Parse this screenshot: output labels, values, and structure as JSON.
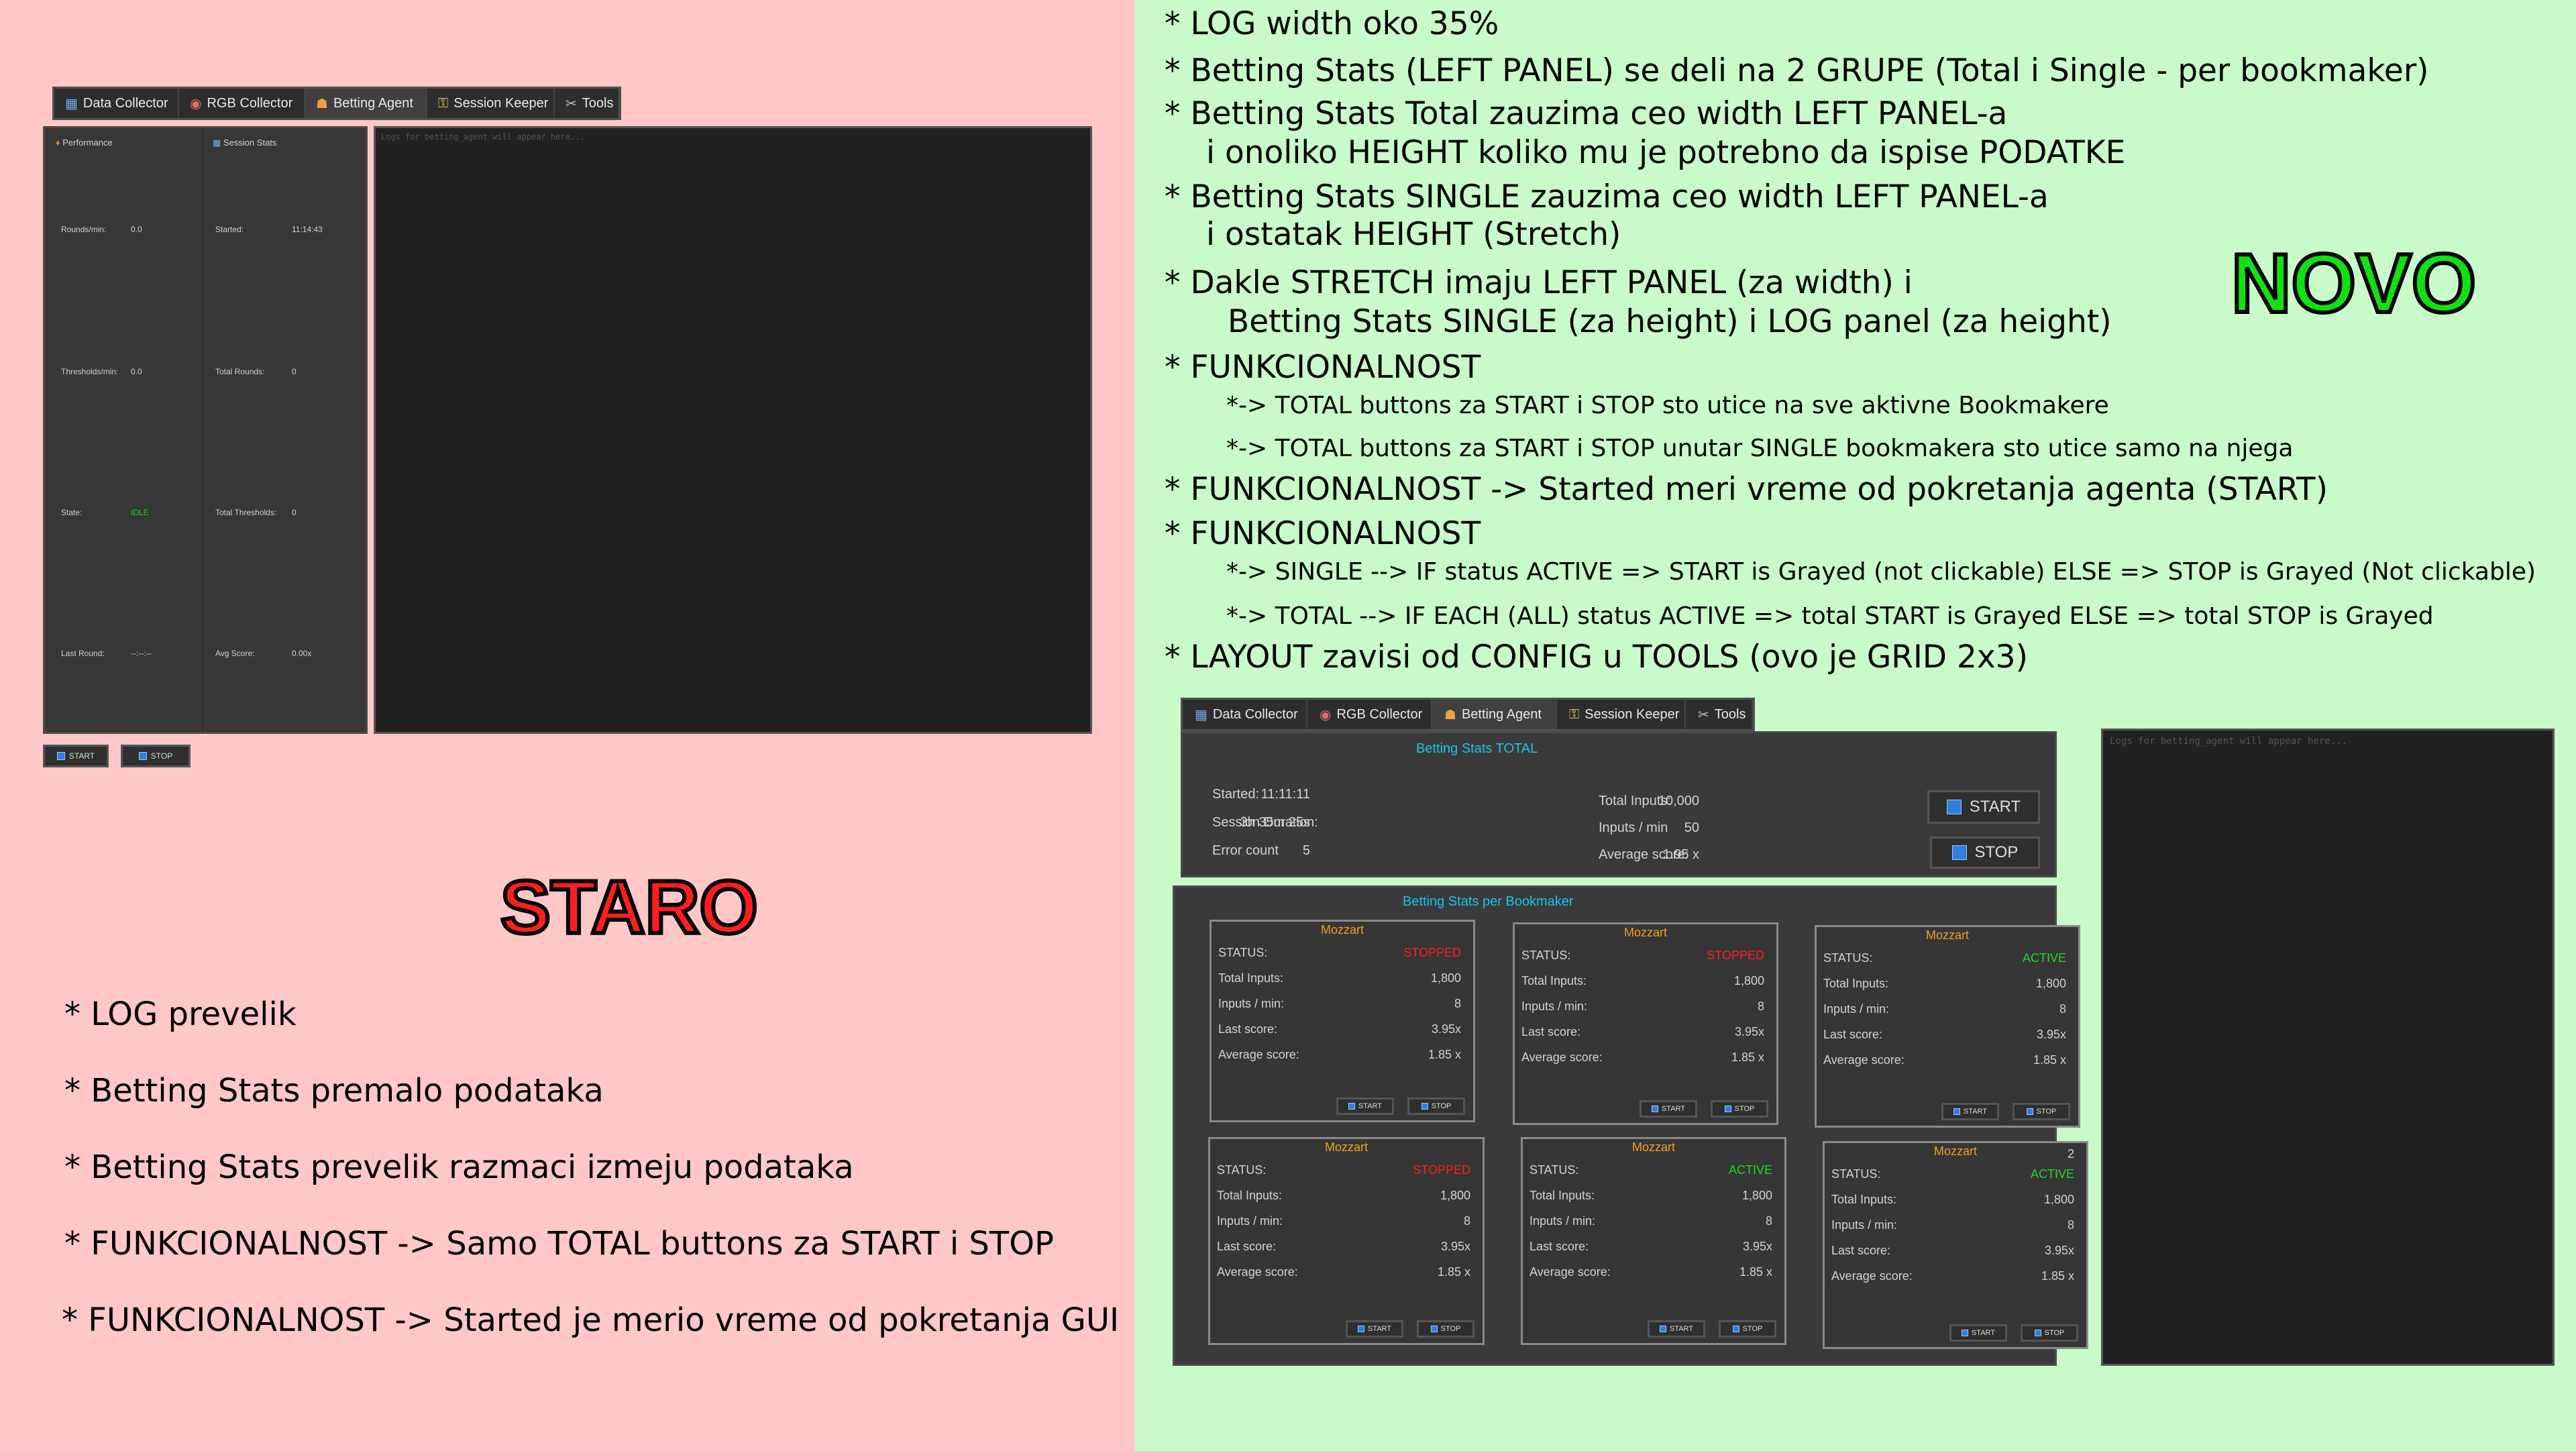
{
  "tabs": [
    {
      "icon": "chart-icon",
      "label": "Data Collector"
    },
    {
      "icon": "palette-icon",
      "label": "RGB Collector"
    },
    {
      "icon": "robot-icon",
      "label": "Betting Agent"
    },
    {
      "icon": "key-icon",
      "label": "Session Keeper"
    },
    {
      "icon": "tools-icon",
      "label": "Tools"
    }
  ],
  "old": {
    "tag": "STARO",
    "performance_title": "Performance",
    "session_title": "Session Stats",
    "perf_rows": [
      {
        "label": "Rounds/min:",
        "value": "0.0"
      },
      {
        "label": "Thresholds/min:",
        "value": "0.0"
      },
      {
        "label": "State:",
        "value": "IDLE"
      },
      {
        "label": "Last Round:",
        "value": "--:--:--"
      }
    ],
    "session_rows": [
      {
        "label": "Started:",
        "value": "11:14:43"
      },
      {
        "label": "Total Rounds:",
        "value": "0"
      },
      {
        "label": "Total Thresholds:",
        "value": "0"
      },
      {
        "label": "Avg Score:",
        "value": "0.00x"
      }
    ],
    "log_placeholder": "Logs for betting_agent will appear here...",
    "start_label": "START",
    "stop_label": "STOP",
    "notes": [
      "* LOG prevelik",
      "* Betting Stats premalo podataka",
      "* Betting Stats prevelik razmaci izmeju podataka",
      "* FUNKCIONALNOST -> Samo TOTAL buttons za START i STOP",
      "* FUNKCIONALNOST -> Started je merio vreme od pokretanja GUI"
    ]
  },
  "new": {
    "tag": "NOVO",
    "notes": [
      {
        "text": "* LOG width oko 35%",
        "size": "big"
      },
      {
        "text": "* Betting Stats (LEFT PANEL) se deli na 2 GRUPE (Total i Single - per bookmaker)",
        "size": "big"
      },
      {
        "text": "* Betting Stats Total zauzima ceo width LEFT PANEL-a",
        "size": "big"
      },
      {
        "text": "i onoliko HEIGHT koliko mu je potrebno da ispise PODATKE",
        "size": "big"
      },
      {
        "text": "* Betting Stats SINGLE zauzima ceo width LEFT PANEL-a",
        "size": "big"
      },
      {
        "text": "i ostatak HEIGHT (Stretch)",
        "size": "big"
      },
      {
        "text": "* Dakle STRETCH imaju LEFT PANEL (za width) i",
        "size": "big"
      },
      {
        "text": "Betting Stats SINGLE (za height) i LOG panel (za height)",
        "size": "big"
      },
      {
        "text": "* FUNKCIONALNOST",
        "size": "big"
      },
      {
        "text": "*-> TOTAL buttons za START i STOP sto utice na sve aktivne Bookmakere",
        "size": "small"
      },
      {
        "text": "*-> TOTAL buttons za START i STOP unutar SINGLE bookmakera sto utice samo na njega",
        "size": "small"
      },
      {
        "text": "* FUNKCIONALNOST -> Started meri vreme od pokretanja agenta (START)",
        "size": "big"
      },
      {
        "text": "* FUNKCIONALNOST",
        "size": "big"
      },
      {
        "text": "*-> SINGLE --> IF status ACTIVE => START is Grayed (not clickable) ELSE => STOP is Grayed (Not clickable)",
        "size": "small"
      },
      {
        "text": "*-> TOTAL --> IF EACH (ALL) status ACTIVE => total START is Grayed ELSE => total STOP is Grayed",
        "size": "small"
      },
      {
        "text": "* LAYOUT zavisi od CONFIG u TOOLS (ovo je GRID 2x3)",
        "size": "big"
      }
    ],
    "total": {
      "title": "Betting Stats TOTAL",
      "left_rows": [
        {
          "label": "Started:",
          "value": "11:11:11"
        },
        {
          "label": "Session Duration:",
          "value": "3h 35m 25s"
        },
        {
          "label": "Error count",
          "value": "5"
        }
      ],
      "right_rows": [
        {
          "label": "Total Inputs:",
          "value": "10,000"
        },
        {
          "label": "Inputs / min",
          "value": "50"
        },
        {
          "label": "Average score:",
          "value": "1.95 x"
        }
      ],
      "start_label": "START",
      "stop_label": "STOP"
    },
    "per_bookmaker_title": "Betting Stats per Bookmaker",
    "status_label": "STATUS:",
    "row_labels": [
      "Total Inputs:",
      "Inputs / min:",
      "Last score:",
      "Average score:"
    ],
    "start_label": "START",
    "stop_label": "STOP",
    "bookmakers": [
      {
        "name": "Mozzart",
        "status": "STOPPED",
        "status_color": "#ff2020",
        "values": [
          "1,800",
          "8",
          "3.95x",
          "1.85 x"
        ],
        "extra": ""
      },
      {
        "name": "Mozzart",
        "status": "STOPPED",
        "status_color": "#ff2020",
        "values": [
          "1,800",
          "8",
          "3.95x",
          "1.85 x"
        ],
        "extra": ""
      },
      {
        "name": "Mozzart",
        "status": "ACTIVE",
        "status_color": "#22d622",
        "values": [
          "1,800",
          "8",
          "3.95x",
          "1.85 x"
        ],
        "extra": ""
      },
      {
        "name": "Mozzart",
        "status": "STOPPED",
        "status_color": "#ff2020",
        "values": [
          "1,800",
          "8",
          "3.95x",
          "1.85 x"
        ],
        "extra": ""
      },
      {
        "name": "Mozzart",
        "status": "ACTIVE",
        "status_color": "#22d622",
        "values": [
          "1,800",
          "8",
          "3.95x",
          "1.85 x"
        ],
        "extra": ""
      },
      {
        "name": "Mozzart",
        "status": "ACTIVE",
        "status_color": "#22d622",
        "values": [
          "1,800",
          "8",
          "3.95x",
          "1.85 x"
        ],
        "extra": "2"
      }
    ],
    "log_placeholder": "Logs for betting_agent will appear here..."
  }
}
